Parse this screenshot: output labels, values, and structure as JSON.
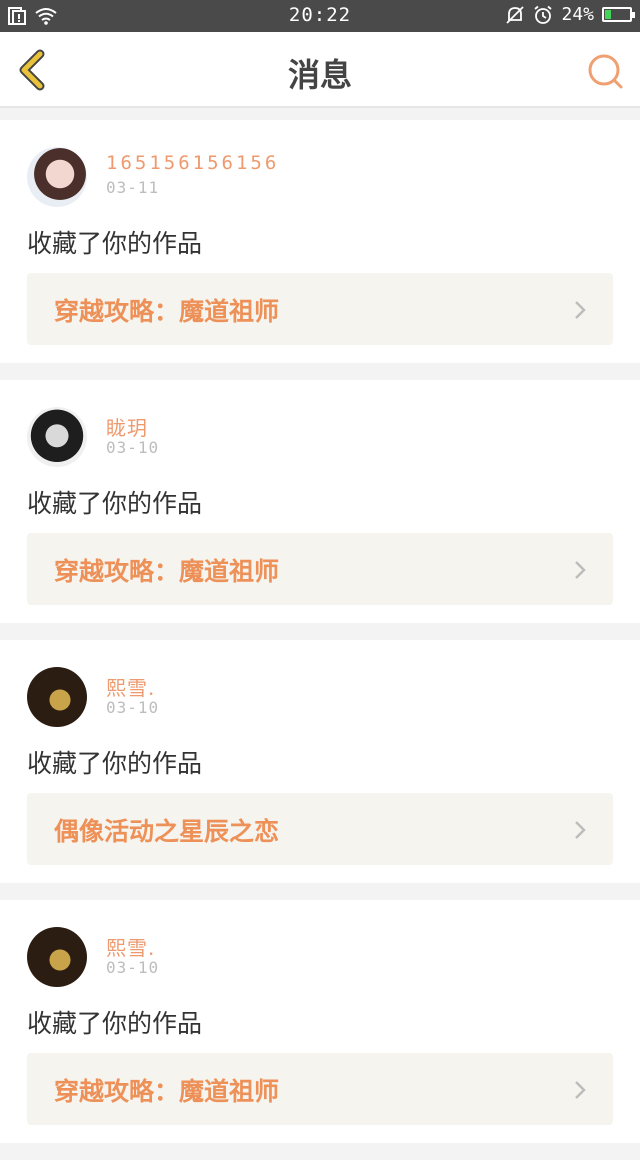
{
  "status_bar": {
    "time": "20:22",
    "battery_percent": "24%",
    "battery_level": 0.24,
    "icons": [
      "notification-icon",
      "wifi-icon",
      "mute-icon",
      "alarm-icon",
      "battery-icon"
    ]
  },
  "header": {
    "title": "消息",
    "back_icon": "chevron-left-icon",
    "search_icon": "search-icon"
  },
  "colors": {
    "accent": "#ee9158",
    "back_icon": "#e8c23a",
    "card_bg": "#ffffff",
    "link_bg": "#f5f4ef"
  },
  "messages": [
    {
      "username": "165156156156",
      "date": "03-11",
      "action": "收藏了你的作品",
      "work_title": "穿越攻略：魔道祖师"
    },
    {
      "username": "眬玥",
      "date": "03-10",
      "action": "收藏了你的作品",
      "work_title": "穿越攻略：魔道祖师"
    },
    {
      "username": "熙雪.",
      "date": "03-10",
      "action": "收藏了你的作品",
      "work_title": "偶像活动之星辰之恋"
    },
    {
      "username": "熙雪.",
      "date": "03-10",
      "action": "收藏了你的作品",
      "work_title": "穿越攻略：魔道祖师"
    }
  ]
}
